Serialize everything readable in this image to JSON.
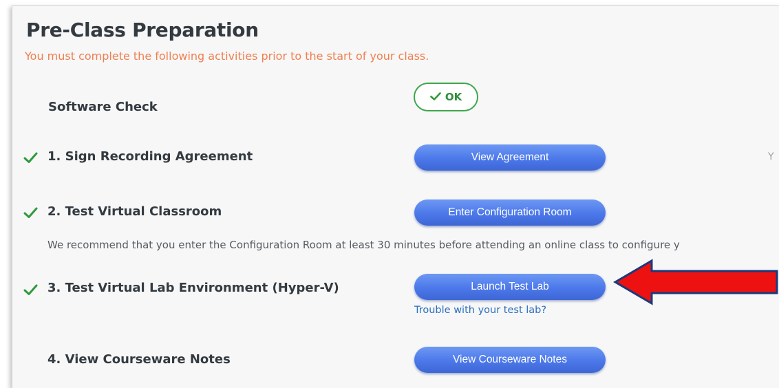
{
  "header": {
    "title": "Pre-Class Preparation",
    "subtitle": "You must complete the following activities prior to the start of your class."
  },
  "software_check": {
    "label": "Software Check",
    "status": "OK"
  },
  "steps": [
    {
      "label": "1. Sign Recording Agreement",
      "completed": true,
      "button": "View Agreement"
    },
    {
      "label": "2. Test Virtual Classroom",
      "completed": true,
      "button": "Enter Configuration Room",
      "note": "We recommend that you enter the Configuration Room at least 30 minutes before attending an online class to configure y"
    },
    {
      "label": "3. Test Virtual Lab Environment (Hyper-V)",
      "completed": true,
      "button": "Launch Test Lab",
      "help_link": "Trouble with your test lab?"
    },
    {
      "label": "4. View Courseware Notes",
      "completed": false,
      "button": "View Courseware Notes"
    }
  ],
  "edge_fragment": "Y",
  "colors": {
    "accent_orange": "#f07e4f",
    "button_blue": "#4c78ea",
    "check_green": "#2f9a3c",
    "link_blue": "#2a6fbf",
    "annotation_red": "#ee1111"
  },
  "icons": {
    "completed": "checkmark-icon",
    "status_ok": "checkmark-icon",
    "annotation": "red-arrow-icon"
  }
}
